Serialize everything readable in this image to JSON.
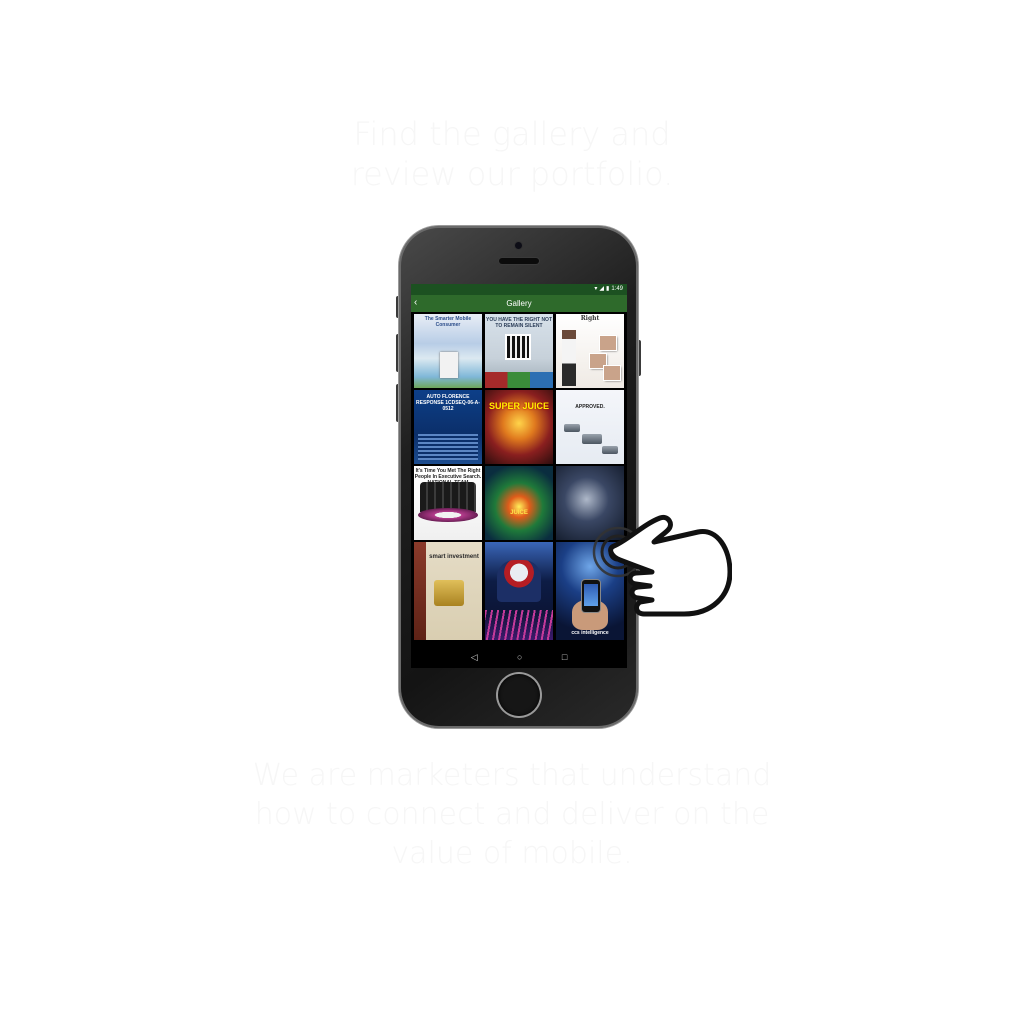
{
  "promo": {
    "headline_line1": "Find the gallery and",
    "headline_line2": "review our portfolio.",
    "tagline_line1": "We are marketers that understand",
    "tagline_line2": "how to connect and deliver on the",
    "tagline_line3": "value of mobile."
  },
  "status_bar": {
    "time": "1:49",
    "wifi_icon": "wifi-icon",
    "signal_icon": "signal-icon",
    "battery_icon": "battery-icon"
  },
  "app_bar": {
    "back_icon": "chevron-left-icon",
    "back_glyph": "‹",
    "title": "Gallery",
    "color": "#2e6a2b",
    "status_color": "#1c5121"
  },
  "gallery": {
    "items": [
      {
        "caption": "The Smarter Mobile Consumer"
      },
      {
        "caption": "YOU HAVE THE RIGHT NOT TO REMAIN SILENT"
      },
      {
        "caption": "Right"
      },
      {
        "caption": "AUTO FLORENCE RESPONSE 1CDSEQ-06-A-0512"
      },
      {
        "caption": "SUPER JUICE"
      },
      {
        "caption": "APPROVED."
      },
      {
        "caption": "It's Time You Met The Right People In Executive Search. NATIONAL TEAM"
      },
      {
        "caption": "JUICE"
      },
      {
        "caption": ""
      },
      {
        "caption": "smart investment"
      },
      {
        "caption": ""
      },
      {
        "caption": "ccs intelligence"
      }
    ]
  },
  "nav_bar": {
    "back_icon": "triangle-back-icon",
    "back_glyph": "◁",
    "home_icon": "circle-home-icon",
    "home_glyph": "○",
    "recents_icon": "square-recents-icon",
    "recents_glyph": "□"
  },
  "overlay": {
    "hand_icon": "tap-hand-icon"
  }
}
